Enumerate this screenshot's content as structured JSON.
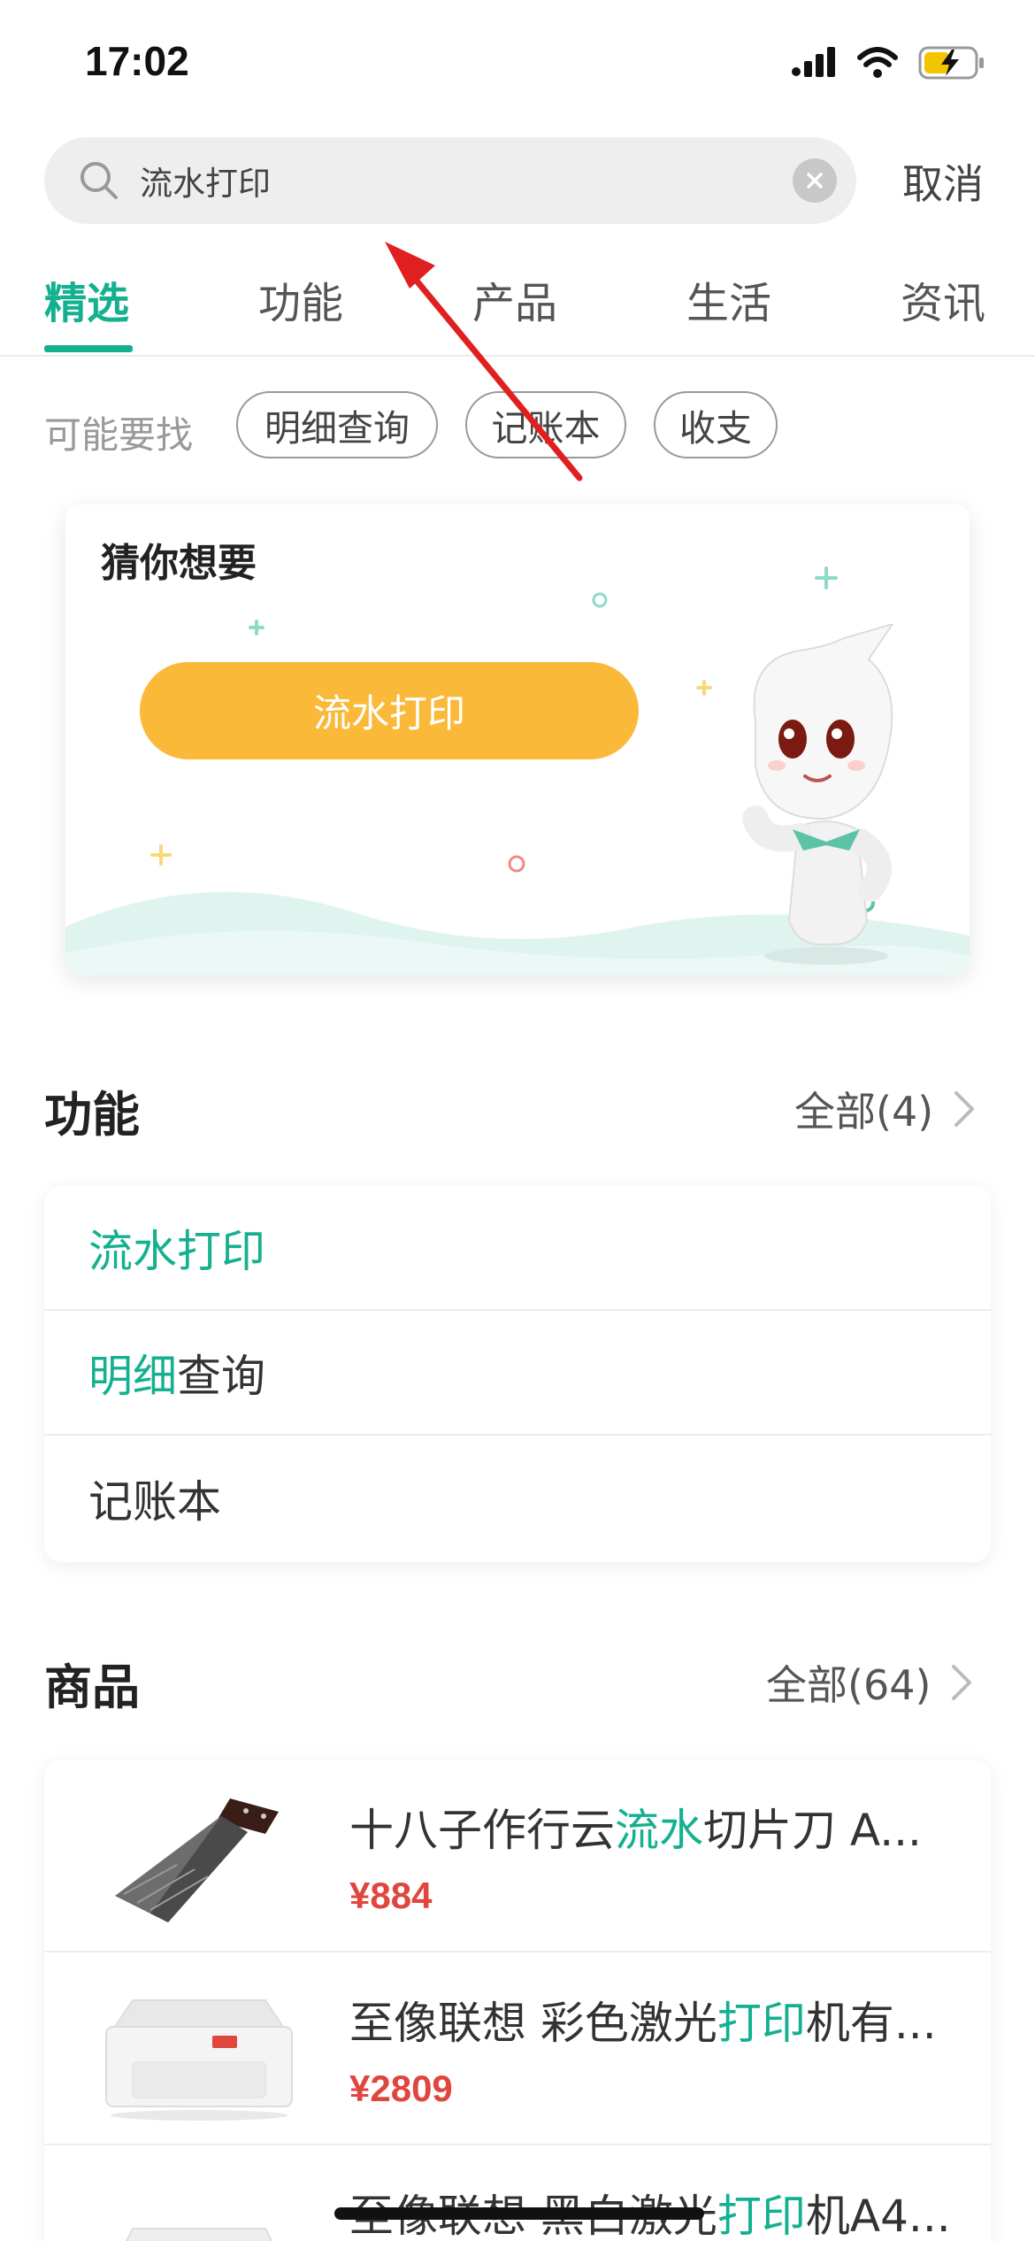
{
  "status_bar": {
    "time": "17:02"
  },
  "search": {
    "query": "流水打印",
    "cancel_label": "取消"
  },
  "tabs": [
    {
      "label": "精选",
      "active": true
    },
    {
      "label": "功能"
    },
    {
      "label": "产品"
    },
    {
      "label": "生活"
    },
    {
      "label": "资讯"
    }
  ],
  "suggestions": {
    "label": "可能要找",
    "chips": [
      "明细查询",
      "记账本",
      "收支"
    ]
  },
  "guess": {
    "title": "猜你想要",
    "button": "流水打印"
  },
  "functions": {
    "title": "功能",
    "more": "全部(4)",
    "items": [
      {
        "hl": "流水打印",
        "rest": ""
      },
      {
        "hl": "明细",
        "rest": "查询"
      },
      {
        "hl": "",
        "rest": "记账本"
      }
    ]
  },
  "products": {
    "title": "商品",
    "more": "全部(64)",
    "items": [
      {
        "pre": "十八子作行云",
        "hl": "流水",
        "post": "切片刀 A...",
        "price": "¥884"
      },
      {
        "pre": "至像联想 彩色激光",
        "hl": "打印",
        "post": "机有...",
        "price": "¥2809"
      },
      {
        "pre": "至像联想 黑白激光",
        "hl": "打印",
        "post": "机A4...",
        "price": ""
      }
    ]
  },
  "colors": {
    "accent": "#14b08f",
    "button": "#fbb93a",
    "price": "#e0463e",
    "annotation_arrow": "#e02020"
  },
  "icons": [
    "signal-icon",
    "wifi-icon",
    "battery-charging-icon",
    "search-icon",
    "clear-icon",
    "chevron-right-icon"
  ]
}
